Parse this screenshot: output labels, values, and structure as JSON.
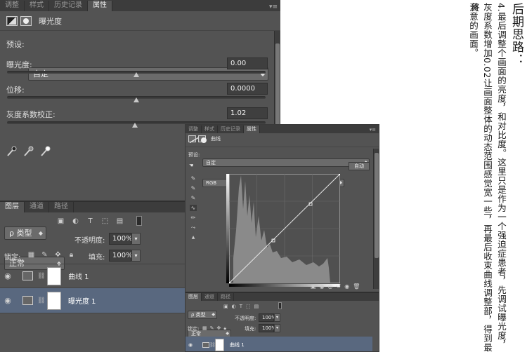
{
  "panel1": {
    "tabs": [
      "调整",
      "样式",
      "历史记录",
      "属性"
    ],
    "active_tab": 3,
    "title": "曝光度",
    "preset_label": "预设:",
    "preset_value": "自定",
    "exposure_label": "曝光度:",
    "exposure_value": "0.00",
    "offset_label": "位移:",
    "offset_value": "0.0000",
    "gamma_label": "灰度系数校正:",
    "gamma_value": "1.02",
    "layers": {
      "tabs": [
        "图层",
        "通道",
        "路径"
      ],
      "kind_label": "ρ 类型",
      "blend_mode": "正常",
      "opacity_label": "不透明度:",
      "opacity_value": "100%",
      "lock_label": "锁定:",
      "fill_label": "填充:",
      "fill_value": "100%",
      "rows": [
        {
          "name": "曲线 1",
          "selected": false
        },
        {
          "name": "曝光度 1",
          "selected": true
        }
      ]
    }
  },
  "panel2": {
    "tabs": [
      "调整",
      "样式",
      "历史记录",
      "属性"
    ],
    "active_tab": 3,
    "title": "曲线",
    "preset_label": "预设:",
    "preset_value": "自定",
    "channel_value": "RGB",
    "auto_label": "自动",
    "layers": {
      "tabs": [
        "图层",
        "通道",
        "路径"
      ],
      "kind_label": "ρ 类型",
      "blend_mode": "正常",
      "opacity_label": "不透明度:",
      "opacity_value": "100%",
      "lock_label": "锁定:",
      "fill_label": "填充:",
      "fill_value": "100%",
      "rows": [
        {
          "name": "曲线 1",
          "selected": true
        }
      ]
    }
  },
  "notes": {
    "heading": "后期思路：",
    "lines": [
      "4.最后调整个画面的亮度，和对比度。这里只是作为一个强迫症患者，先调试曝光度，",
      "灰度系数增加0.02让画面整体的动态范围感觉宽一些，再最后收束曲线调整部，得到最终",
      "满意的画面。"
    ]
  },
  "colors": {
    "panel_bg": "#535353",
    "tabbar_bg": "#3c3c3c",
    "selected_row": "#59687f"
  }
}
